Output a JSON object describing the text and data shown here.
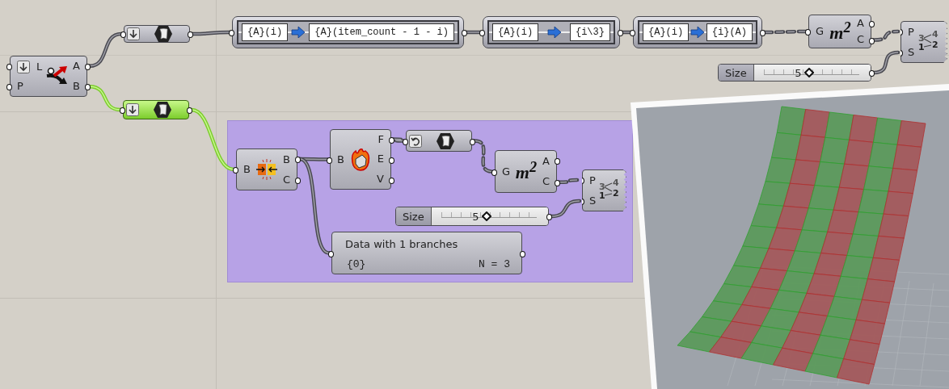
{
  "canvas": {
    "nodes": [
      {
        "kind": "component",
        "inputs": [
          "L",
          "P"
        ],
        "outputs": [
          "A",
          "B"
        ]
      },
      {
        "kind": "param",
        "selected": false
      },
      {
        "kind": "param",
        "selected": true
      },
      {
        "kind": "expression",
        "from": "{A}(i)",
        "to": "{A}(item_count - 1 - i)"
      },
      {
        "kind": "expression",
        "from": "{A}(i)",
        "to": "{i\\3}"
      },
      {
        "kind": "expression",
        "from": "{A}(i)",
        "to": "{i}(A)"
      },
      {
        "kind": "component",
        "symbol": "m$^{2}$",
        "inputs": [
          "G"
        ],
        "outputs": [
          "A",
          "C"
        ]
      },
      {
        "kind": "component",
        "digits": [
          "3",
          "4",
          "1",
          "2"
        ],
        "inputs": [
          "P",
          "S"
        ]
      },
      {
        "kind": "slider",
        "label": "Size",
        "value": "5",
        "level": 0.48
      }
    ],
    "group": {
      "nodes": [
        {
          "kind": "component",
          "inputs": [
            "B"
          ],
          "outputs": [
            "B",
            "C"
          ]
        },
        {
          "kind": "component",
          "inputs": [
            "B"
          ],
          "outputs": [
            "F",
            "E",
            "V"
          ]
        },
        {
          "kind": "param",
          "selected": false
        },
        {
          "kind": "component",
          "symbol": "m$^{2}$",
          "inputs": [
            "G"
          ],
          "outputs": [
            "A",
            "C"
          ]
        },
        {
          "kind": "component",
          "digits": [
            "3",
            "4",
            "1",
            "2"
          ],
          "inputs": [
            "P",
            "S"
          ]
        },
        {
          "kind": "slider",
          "label": "Size",
          "value": "5",
          "level": 0.48
        },
        {
          "kind": "panel",
          "title": "Data with 1 branches",
          "path": "{0}",
          "count": "N = 3"
        }
      ]
    }
  }
}
